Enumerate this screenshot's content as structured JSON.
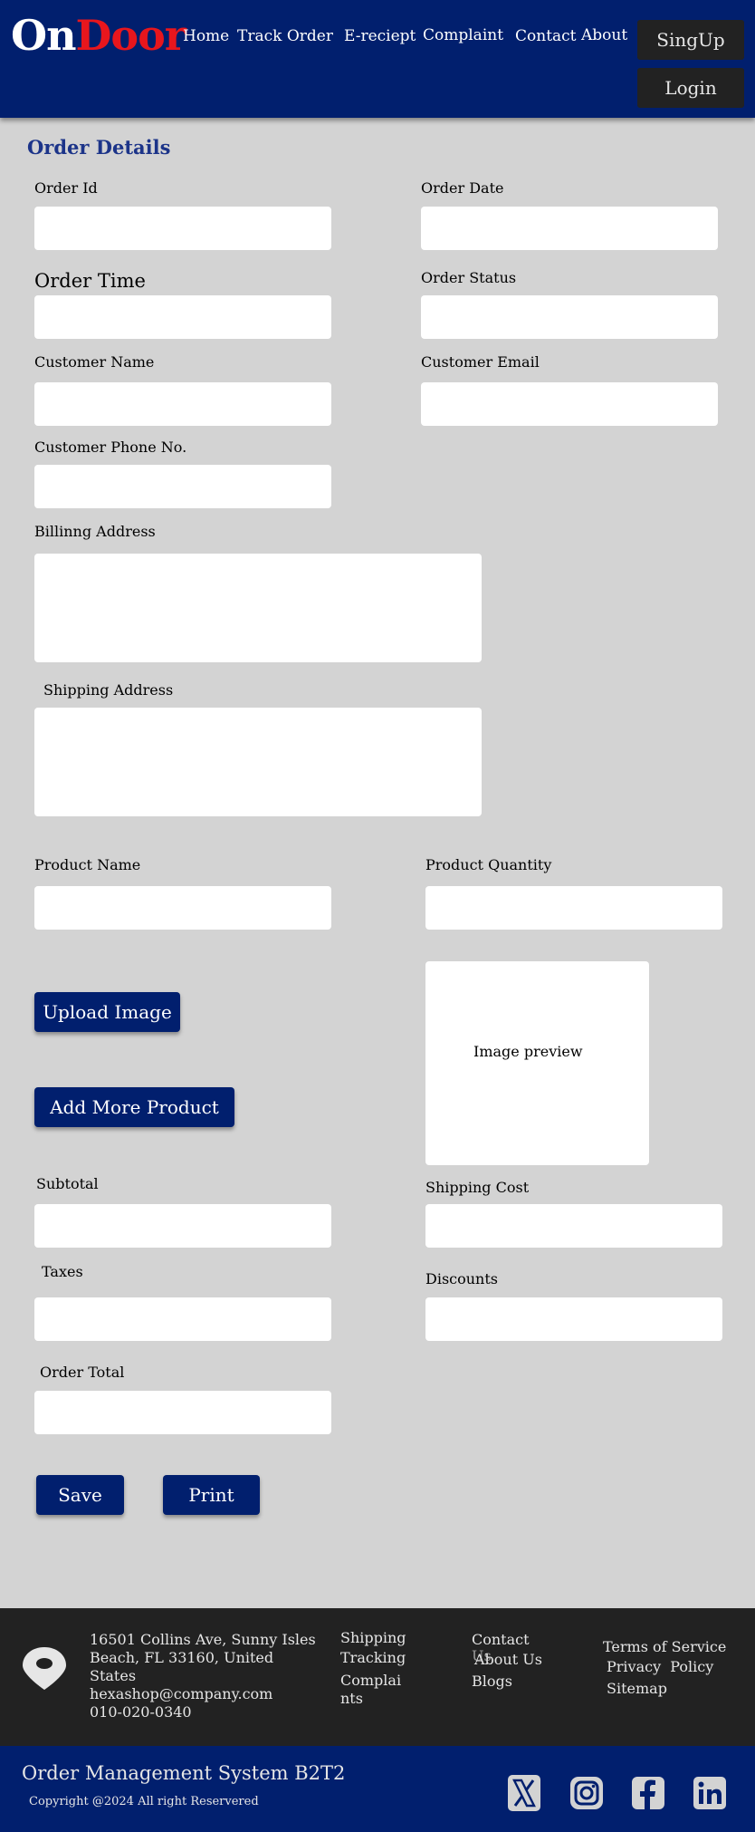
{
  "header": {
    "logo_on": "On",
    "logo_door": "Door",
    "nav": [
      "Home",
      "Track Order",
      "E-reciept",
      "Complaint",
      "Contact",
      "About"
    ],
    "signup": "SingUp",
    "login": "Login"
  },
  "form": {
    "title": "Order Details",
    "order_id": "Order Id",
    "order_date": "Order Date",
    "order_time": "Order Time",
    "order_status": "Order Status",
    "customer_name": "Customer Name",
    "customer_email": "Customer Email",
    "customer_phone": "Customer Phone No.",
    "billing_address": "Billinng Address",
    "shipping_address": "Shipping Address",
    "product_name": "Product Name",
    "product_quantity": "Product Quantity",
    "upload_image": "Upload Image",
    "image_preview": "Image preview",
    "add_more_product": "Add More Product",
    "subtotal": "Subtotal",
    "shipping_cost": "Shipping Cost",
    "taxes": "Taxes",
    "discounts": "Discounts",
    "order_total": "Order Total",
    "save": "Save",
    "print": "Print"
  },
  "footer": {
    "address1": "16501 Collins Ave, Sunny Isles",
    "address2": "Beach, FL 33160, United",
    "address3": "States",
    "email": "hexashop@company.com",
    "phone": "010-020-0340",
    "shipping": "Shipping",
    "tracking": "Tracking",
    "complaints1": "Complai",
    "complaints2": "nts",
    "contact": "Contact",
    "contact_us_overlap": "Us",
    "about_us": "About Us",
    "blogs": "Blogs",
    "terms": "Terms of Service",
    "privacy": "Privacy  Policy",
    "sitemap": "Sitemap",
    "system_name": "Order Management System B2T2",
    "copyright": "Copyright @2024 All right Reservered"
  },
  "colors": {
    "brand_navy": "#011f6e",
    "logo_red": "#e8161d",
    "background": "#d3d3d3",
    "footer_dark": "#222222"
  }
}
